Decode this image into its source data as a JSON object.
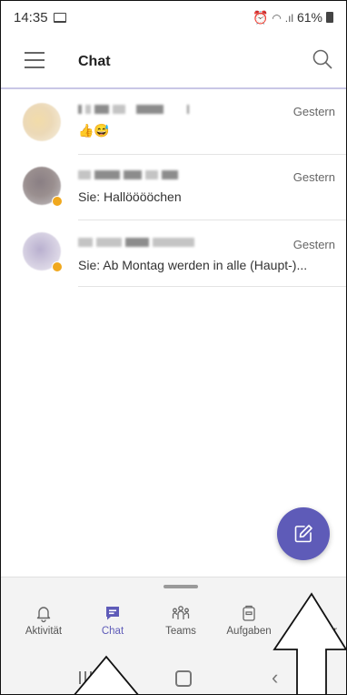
{
  "status_bar": {
    "time": "14:35",
    "right_text": "61%",
    "icons": [
      "laptop-icon",
      "alarm-icon",
      "wifi-icon",
      "signal-icon",
      "battery-icon"
    ]
  },
  "header": {
    "title": "Chat",
    "icons": [
      "menu-icon",
      "search-icon"
    ]
  },
  "chats": [
    {
      "name_visible": "S i",
      "time": "Gestern",
      "preview": "👍😅",
      "presence": "none"
    },
    {
      "name_visible": "",
      "time": "Gestern",
      "preview": "Sie: Hallööööchen",
      "presence": "away"
    },
    {
      "name_visible": "",
      "time": "Gestern",
      "preview": "Sie: Ab Montag werden in alle (Haupt-)...",
      "presence": "away"
    }
  ],
  "fab": {
    "icon": "compose-icon"
  },
  "bottom_nav": [
    {
      "label": "Aktivität",
      "icon": "bell-icon",
      "active": false
    },
    {
      "label": "Chat",
      "icon": "chat-icon",
      "active": true
    },
    {
      "label": "Teams",
      "icon": "teams-icon",
      "active": false
    },
    {
      "label": "Aufgaben",
      "icon": "tasks-icon",
      "active": false
    },
    {
      "label": "er",
      "icon": "more-icon",
      "active": false
    }
  ],
  "system_nav": {
    "icons": [
      "recents-icon",
      "home-icon",
      "back-icon"
    ]
  },
  "colors": {
    "accent": "#5e5bb8",
    "presence_away": "#f0a81e",
    "nav_bg": "#f3f3f3"
  }
}
